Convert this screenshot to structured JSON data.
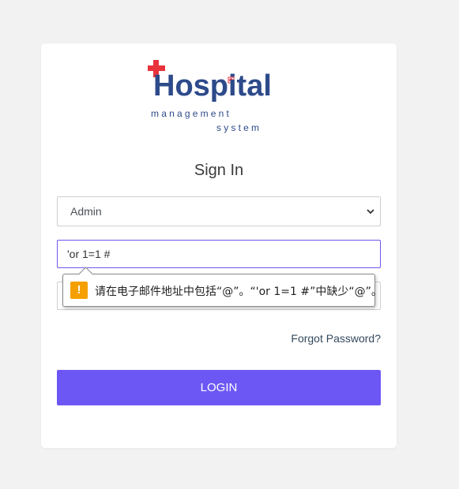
{
  "logo": {
    "word": "Hospital",
    "line1": "management",
    "line2": "system",
    "cross_color": "#e8323c",
    "text_color": "#2d4a8a"
  },
  "form": {
    "title": "Sign In",
    "role_select_value": "Admin",
    "email_value": "'or 1=1 #",
    "forgot_label": "Forgot Password?",
    "login_label": "LOGIN"
  },
  "validation_tooltip": {
    "icon": "warning-icon",
    "message": "请在电子邮件地址中包括“@”。“'or 1=1 #”中缺少“@”。"
  },
  "colors": {
    "accent": "#6c57f5",
    "focus_border": "#6d57f2",
    "warning": "#f5a000"
  }
}
